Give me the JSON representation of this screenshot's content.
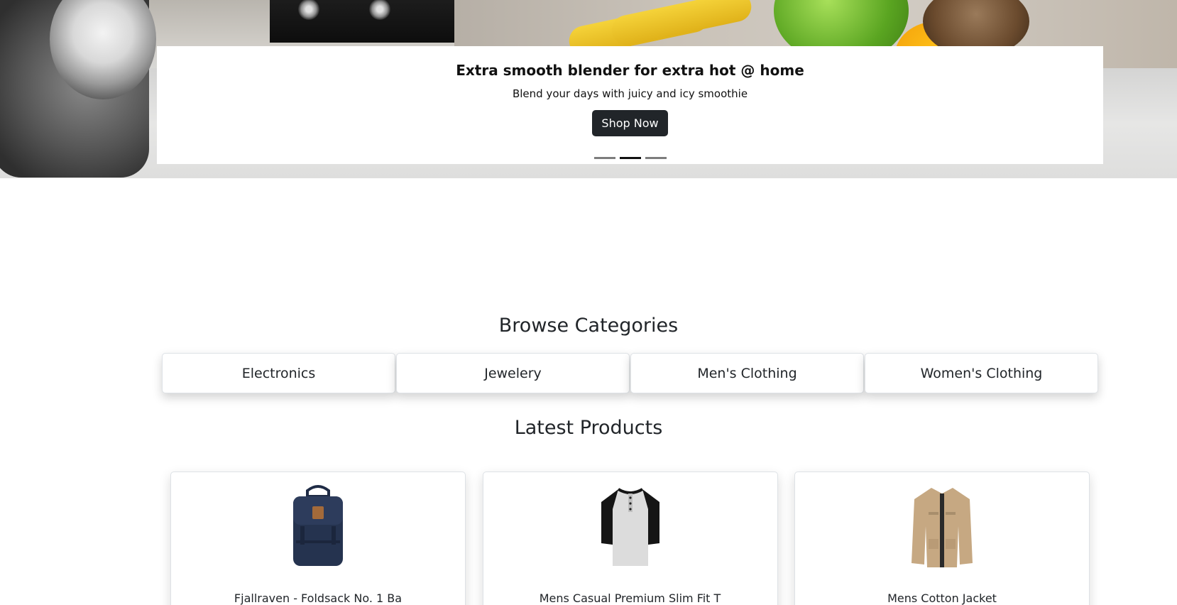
{
  "hero": {
    "title": "Extra smooth blender for extra hot @ home",
    "subtitle": "Blend your days with juicy and icy smoothie",
    "cta_label": "Shop Now",
    "active_slide": 2,
    "slide_count": 3
  },
  "categories": {
    "heading": "Browse Categories",
    "items": [
      {
        "label": "Electronics"
      },
      {
        "label": "Jewelery"
      },
      {
        "label": "Men's Clothing"
      },
      {
        "label": "Women's Clothing"
      }
    ]
  },
  "products": {
    "heading": "Latest Products",
    "items": [
      {
        "name": "Fjallraven - Foldsack No. 1 Ba",
        "icon": "backpack-image"
      },
      {
        "name": "Mens Casual Premium Slim Fit T",
        "icon": "henley-shirt-image"
      },
      {
        "name": "Mens Cotton Jacket",
        "icon": "jacket-image"
      }
    ]
  },
  "colors": {
    "button_dark": "#212529",
    "text": "#212529",
    "indicator_active": "#111111",
    "indicator_inactive": "#7d7d7d"
  }
}
